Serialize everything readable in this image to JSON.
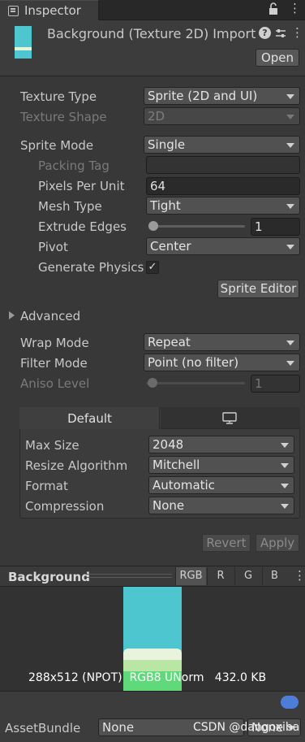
{
  "window": {
    "tab_title": "Inspector",
    "header_title": "Background (Texture 2D) Import",
    "open_button": "Open"
  },
  "texture": {
    "texture_type_label": "Texture Type",
    "texture_type_value": "Sprite (2D and UI)",
    "texture_shape_label": "Texture Shape",
    "texture_shape_value": "2D",
    "sprite_mode_label": "Sprite Mode",
    "sprite_mode_value": "Single",
    "packing_tag_label": "Packing Tag",
    "packing_tag_value": "",
    "ppu_label": "Pixels Per Unit",
    "ppu_value": "64",
    "mesh_type_label": "Mesh Type",
    "mesh_type_value": "Tight",
    "extrude_label": "Extrude Edges",
    "extrude_value": "1",
    "pivot_label": "Pivot",
    "pivot_value": "Center",
    "physics_label": "Generate Physics",
    "physics_checked": true,
    "sprite_editor_button": "Sprite Editor"
  },
  "advanced": {
    "label": "Advanced",
    "wrap_label": "Wrap Mode",
    "wrap_value": "Repeat",
    "filter_label": "Filter Mode",
    "filter_value": "Point (no filter)",
    "aniso_label": "Aniso Level",
    "aniso_value": "1"
  },
  "platform": {
    "default_tab": "Default",
    "max_size_label": "Max Size",
    "max_size_value": "2048",
    "resize_label": "Resize Algorithm",
    "resize_value": "Mitchell",
    "format_label": "Format",
    "format_value": "Automatic",
    "compression_label": "Compression",
    "compression_value": "None"
  },
  "actions": {
    "revert": "Revert",
    "apply": "Apply"
  },
  "preview": {
    "title": "Background",
    "channels": [
      "RGB",
      "R",
      "G",
      "B"
    ],
    "info": "288x512 (NPOT)  RGB8 UNorm   432.0 KB"
  },
  "assetbundle": {
    "label": "AssetBundle",
    "name_value": "None",
    "variant_value": "None",
    "watermark": "CSDN @dangoxiba"
  },
  "colors": {
    "sky": "#4dc6cf",
    "grass": "#5fd97a",
    "background": "#383838"
  }
}
